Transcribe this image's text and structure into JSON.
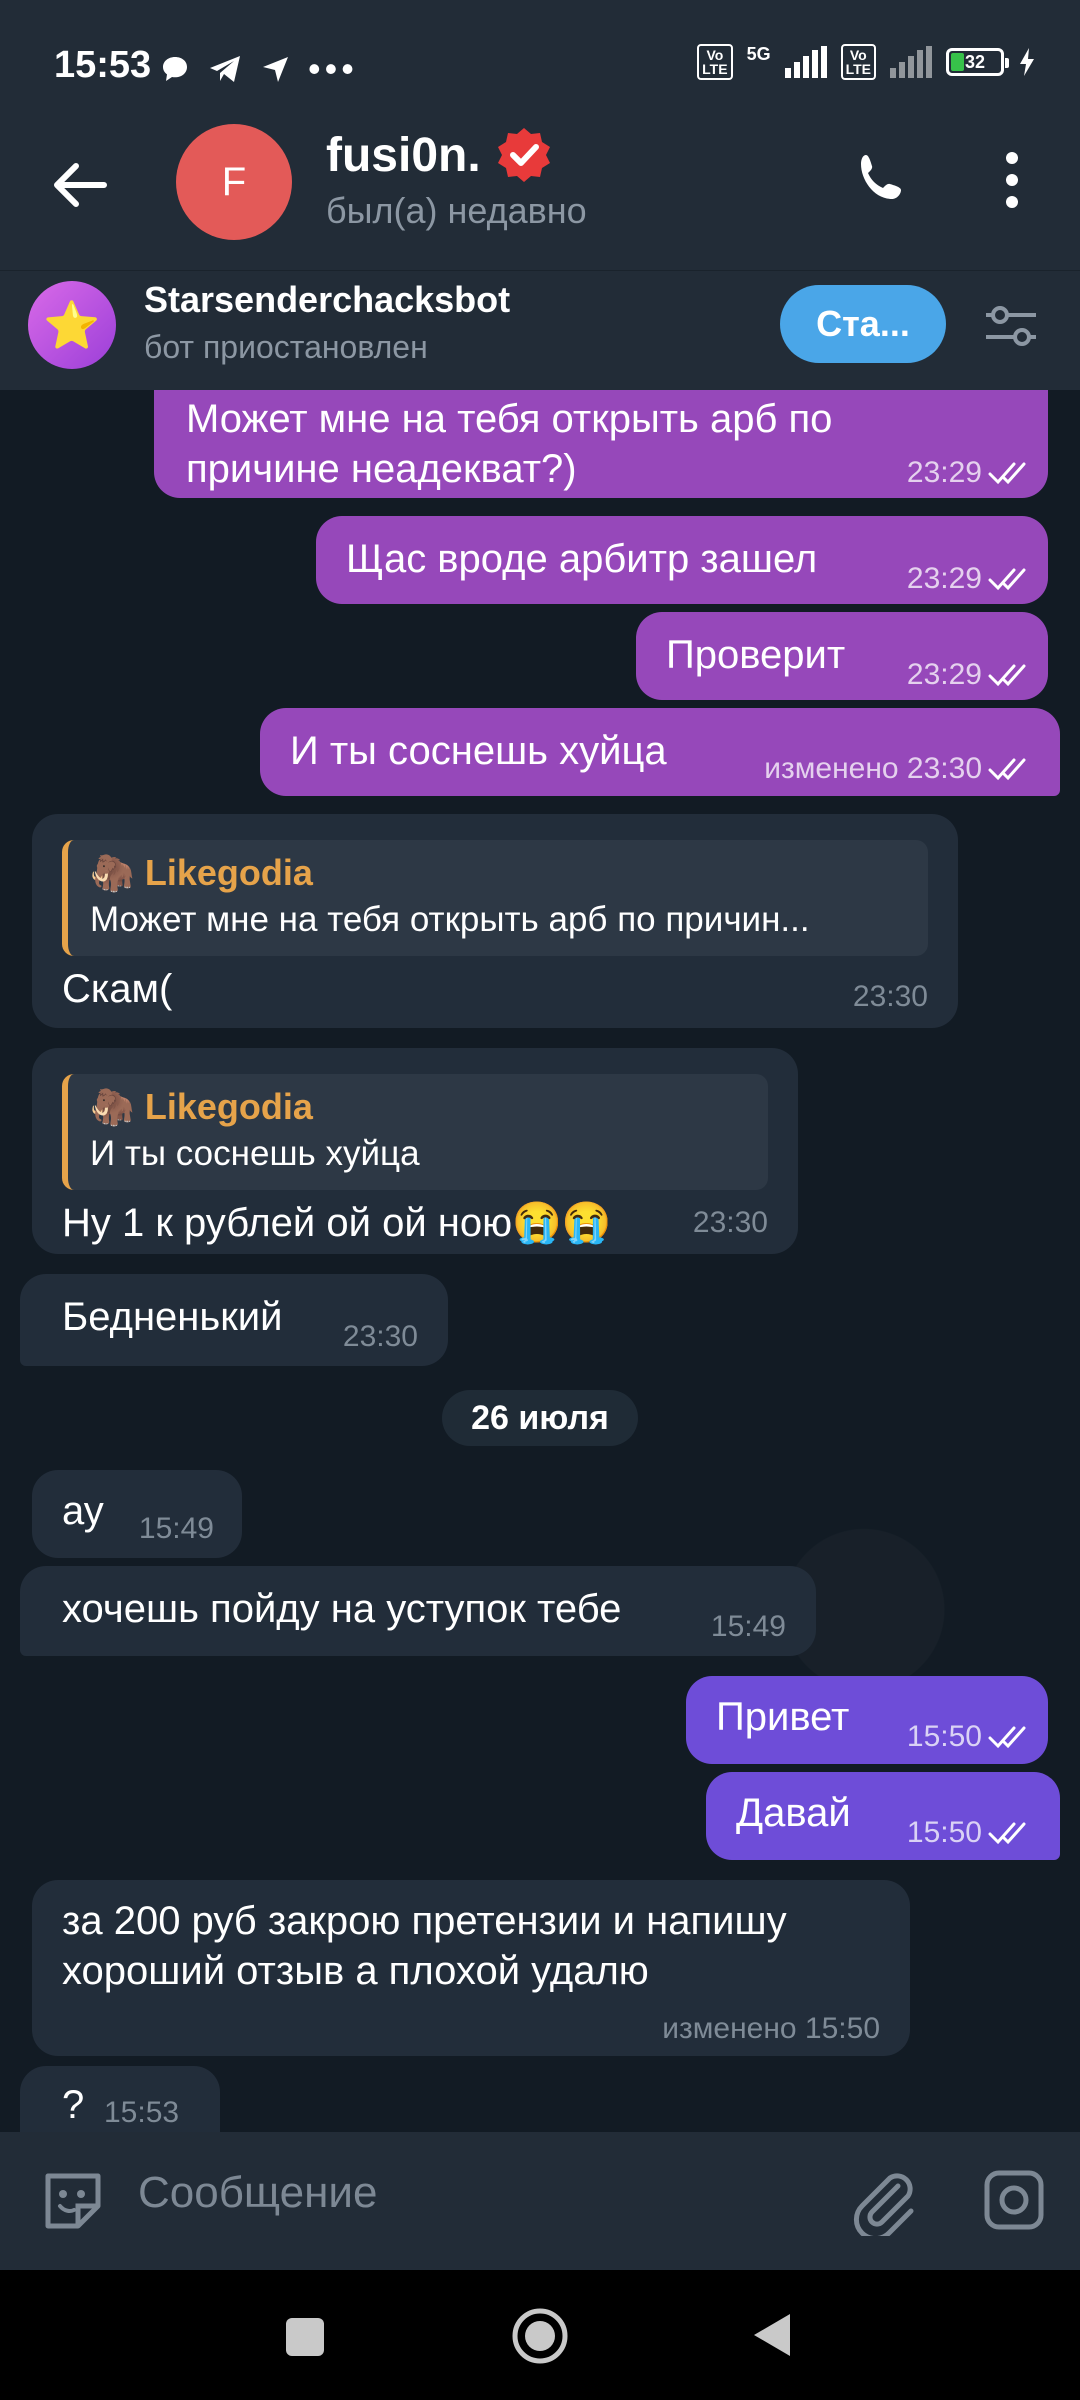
{
  "status_bar": {
    "time": "15:53",
    "network": "5G",
    "volte": "Vo LTE",
    "battery": "32",
    "battery_level": 0.32,
    "icons": [
      "chat-bubble-icon",
      "telegram-icon",
      "location-arrow-icon",
      "more-dots-icon"
    ]
  },
  "header": {
    "avatar_letter": "F",
    "name": "fusi0n.",
    "status": "был(а) недавно",
    "accent": "#e35a58"
  },
  "bot_bar": {
    "name": "Starsenderchacksbot",
    "status": "бот приостановлен",
    "start_label": "Ста...",
    "avatar_icon": "⭐"
  },
  "messages": [
    {
      "dir": "out",
      "text": "Может мне на тебя открыть арб по причине неадекват?)",
      "time": "23:29"
    },
    {
      "dir": "out",
      "text": "Щас вроде арбитр зашел",
      "time": "23:29"
    },
    {
      "dir": "out",
      "text": "Проверит",
      "time": "23:29"
    },
    {
      "dir": "out",
      "text": "И ты соснешь хуйца",
      "time": "изменено 23:30"
    },
    {
      "dir": "in",
      "reply_name": "Likegodia",
      "reply_text": "Может мне на тебя открыть арб по причин...",
      "text": "Скам(",
      "time": "23:30"
    },
    {
      "dir": "in",
      "reply_name": "Likegodia",
      "reply_text": "И ты соснешь хуйца",
      "text": "Ну 1 к рублей ой ой ною😭😭",
      "time": "23:30"
    },
    {
      "dir": "in",
      "text": "Бедненький",
      "time": "23:30"
    },
    {
      "dir": "in",
      "text": "ау",
      "time": "15:49"
    },
    {
      "dir": "in",
      "text": "хочешь пойду на уступок тебе",
      "time": "15:49"
    },
    {
      "dir": "out",
      "text": "Привет",
      "time": "15:50"
    },
    {
      "dir": "out",
      "text": "Давай",
      "time": "15:50"
    },
    {
      "dir": "in",
      "text": "за 200 руб закрою претензии и напишу хороший отзыв а плохой удалю",
      "time": "изменено 15:50"
    },
    {
      "dir": "in",
      "text": "?",
      "time": "15:53"
    }
  ],
  "date_separator": "26 июля",
  "reply_icon": "🦣",
  "input": {
    "placeholder": "Сообщение"
  }
}
